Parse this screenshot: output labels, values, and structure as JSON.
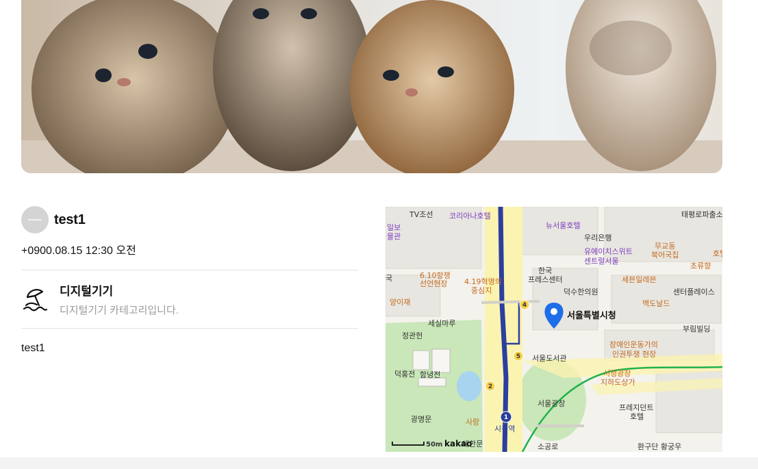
{
  "author": {
    "name": "test1"
  },
  "post": {
    "datetime": "+0900.08.15 12:30 오전",
    "body": "test1"
  },
  "category": {
    "icon": "beach-umbrella-icon",
    "title": "디지털기기",
    "description": "디지털기기 카테고리입니다."
  },
  "map": {
    "marker_label": "서울특별시청",
    "scale_label": "50m",
    "provider": "kakao",
    "labels": {
      "tv": "TV조선",
      "korea_hotel": "코리아나호텔",
      "new_seoul": "뉴서울호텔",
      "taepyeong": "태평로파출소",
      "woori": "우리은행",
      "ilbo": "일보",
      "museum": "물관",
      "june10": "6.10항쟁",
      "june10b": "선언현장",
      "april19": "4.19혁명의",
      "april19b": "중심지",
      "korea": "한국",
      "press": "프레스센터",
      "uphouse": "유에이치스위트",
      "uphouseb": "센트럴서울",
      "mugyo": "무교동",
      "mugyob": "북어국집",
      "hotel_r": "호텔",
      "choryu": "초류향",
      "seven": "세븐일레븐",
      "deoksu": "덕수한의원",
      "center": "센터플레이스",
      "yangi": "양이재",
      "guk": "국",
      "mcd": "맥도날드",
      "sesil": "세실마루",
      "bumil": "부림빌딩",
      "jeonggwan": "정관헌",
      "disabled": "장애인운동가의",
      "disabledb": "인권투쟁 현장",
      "library": "서울도서관",
      "deokhong": "덕홍전",
      "hamnyeong": "함녕전",
      "cityhall_plaza": "서청광장",
      "underground": "지하도상가",
      "seoul_plaza": "서울광장",
      "sarang": "사랑",
      "president": "프레지던트",
      "presidentb": "호텔",
      "gwangmyeong": "광명문",
      "cityhall_stn": "시청역",
      "daehan": "대한문",
      "sogong": "소공로",
      "hwangu": "환구단 황궁우"
    }
  },
  "colors": {
    "line1": "#2b3f9e",
    "line2": "#1fb14b",
    "road_major": "#fbf3b0",
    "park": "#c9e7b8",
    "marker": "#1e6ee8"
  }
}
